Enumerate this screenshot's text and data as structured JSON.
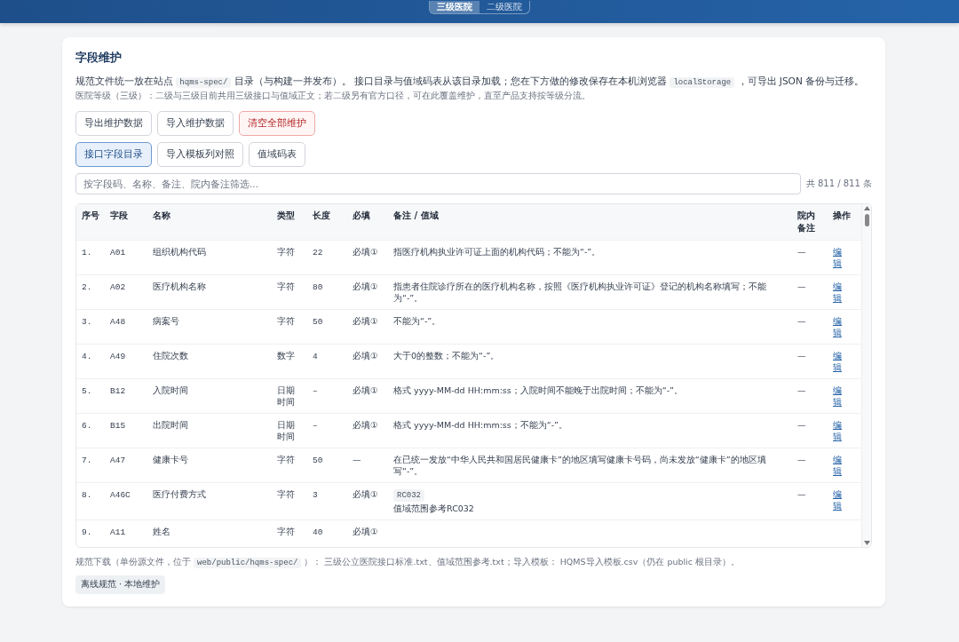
{
  "header": {
    "levels": [
      {
        "label": "三级医院",
        "selected": true
      },
      {
        "label": "二级医院",
        "selected": false
      }
    ]
  },
  "title": "字段维护",
  "intro": [
    {
      "kind": "text",
      "text": "规范文件统一放在站点 "
    },
    {
      "kind": "code",
      "text": "hqms-spec/"
    },
    {
      "kind": "text",
      "text": " 目录（与构建一并发布）。 接口目录与值域码表从该目录加载；您在下方做的修改保存在本机浏览器 "
    },
    {
      "kind": "code",
      "text": "localStorage"
    },
    {
      "kind": "text",
      "text": " ，可导出 JSON 备份与迁移。"
    }
  ],
  "level_note": "医院等级（三级）：二级与三级目前共用三级接口与值域正文；若二级另有官方口径，可在此覆盖维护，直至产品支持按等级分流。",
  "actions": [
    {
      "label": "导出维护数据",
      "kind": "normal"
    },
    {
      "label": "导入维护数据",
      "kind": "normal"
    },
    {
      "label": "清空全部维护",
      "kind": "danger"
    }
  ],
  "tabs": [
    {
      "label": "接口字段目录",
      "selected": true
    },
    {
      "label": "导入模板列对照",
      "selected": false
    },
    {
      "label": "值域码表",
      "selected": false
    }
  ],
  "filter": {
    "placeholder": "按字段码、名称、备注、院内备注筛选..."
  },
  "count": "共 811 / 811 条",
  "table": {
    "columns": [
      "序号",
      "字段",
      "名称",
      "类型",
      "长度",
      "必填",
      "备注 / 值域",
      "院内备注",
      "操作"
    ],
    "rows": [
      {
        "no": "1.",
        "code": "A01",
        "name": "组织机构代码",
        "type": "字符",
        "length": "22",
        "required": "必填①",
        "note": "指医疗机构执业许可证上面的机构代码；不能为“-”。",
        "remark": "—",
        "action": "编辑"
      },
      {
        "no": "2.",
        "code": "A02",
        "name": "医疗机构名称",
        "type": "字符",
        "length": "80",
        "required": "必填①",
        "note": "指患者住院诊疗所在的医疗机构名称，按照《医疗机构执业许可证》登记的机构名称填写；不能为“-”。",
        "remark": "—",
        "action": "编辑"
      },
      {
        "no": "3.",
        "code": "A48",
        "name": "病案号",
        "type": "字符",
        "length": "50",
        "required": "必填①",
        "note": "不能为“-”。",
        "remark": "—",
        "action": "编辑"
      },
      {
        "no": "4.",
        "code": "A49",
        "name": "住院次数",
        "type": "数字",
        "length": "4",
        "required": "必填①",
        "note": "大于0的整数；不能为“-”。",
        "remark": "—",
        "action": "编辑"
      },
      {
        "no": "5.",
        "code": "B12",
        "name": "入院时间",
        "type": "日期时间",
        "length": "–",
        "required": "必填①",
        "note": "格式 yyyy-MM-dd HH:mm:ss；入院时间不能晚于出院时间；不能为“-”。",
        "remark": "—",
        "action": "编辑"
      },
      {
        "no": "6.",
        "code": "B15",
        "name": "出院时间",
        "type": "日期时间",
        "length": "–",
        "required": "必填①",
        "note": "格式 yyyy-MM-dd HH:mm:ss；不能为“-”。",
        "remark": "—",
        "action": "编辑"
      },
      {
        "no": "7.",
        "code": "A47",
        "name": "健康卡号",
        "type": "字符",
        "length": "50",
        "required": "—",
        "note": "在已统一发放“中华人民共和国居民健康卡”的地区填写健康卡号码，尚未发放“健康卡”的地区填写“-”。",
        "remark": "—",
        "action": "编辑"
      },
      {
        "no": "8.",
        "code": "A46C",
        "name": "医疗付费方式",
        "type": "字符",
        "length": "3",
        "required": "必填①",
        "tag": "RC032",
        "note": "值域范围参考RC032",
        "remark": "—",
        "action": "编辑"
      },
      {
        "no": "9.",
        "code": "A11",
        "name": "姓名",
        "type": "字符",
        "length": "40",
        "required": "必填①"
      }
    ]
  },
  "footer": [
    {
      "kind": "text",
      "text": "规范下载（单份源文件，位于 "
    },
    {
      "kind": "code",
      "text": "web/public/hqms-spec/"
    },
    {
      "kind": "text",
      "text": " ）： 三级公立医院接口标准.txt、值域范围参考.txt；导入模板： HQMS导入模板.csv（仍在 public 根目录）。"
    }
  ],
  "badge": "离线规范 · 本地维护"
}
